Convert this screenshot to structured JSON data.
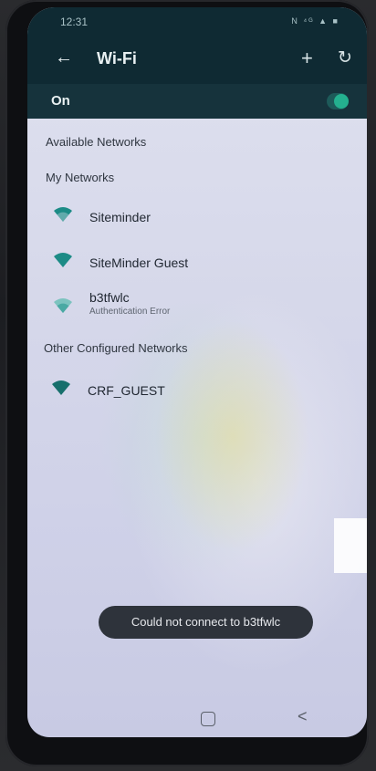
{
  "status_bar": {
    "time": "12:31",
    "indicators": "N ⁴ᴳ ▲ ■"
  },
  "app_bar": {
    "back_icon": "arrow-left-icon",
    "title": "Wi-Fi",
    "add_icon": "plus-icon",
    "refresh_icon": "refresh-icon"
  },
  "wifi_toggle": {
    "label": "On",
    "state": "on"
  },
  "sections": {
    "available": "Available Networks",
    "my_networks": "My Networks",
    "other": "Other Configured Networks"
  },
  "my_networks": [
    {
      "name": "Siteminder",
      "status": ""
    },
    {
      "name": "SiteMinder Guest",
      "status": ""
    },
    {
      "name": "b3tfwlc",
      "status": "Authentication Error"
    }
  ],
  "other_networks": [
    {
      "name": "CRF_GUEST",
      "status": ""
    }
  ],
  "toast": {
    "message": "Could not connect to b3tfwlc"
  },
  "nav_bar": {
    "home_icon": "home-square-icon",
    "back_icon": "chevron-left-icon"
  },
  "colors": {
    "header": "#0f2a33",
    "toggle_on": "#24b08f",
    "wifi_icon": "#1c8b86",
    "toast_bg": "#2e333b"
  }
}
